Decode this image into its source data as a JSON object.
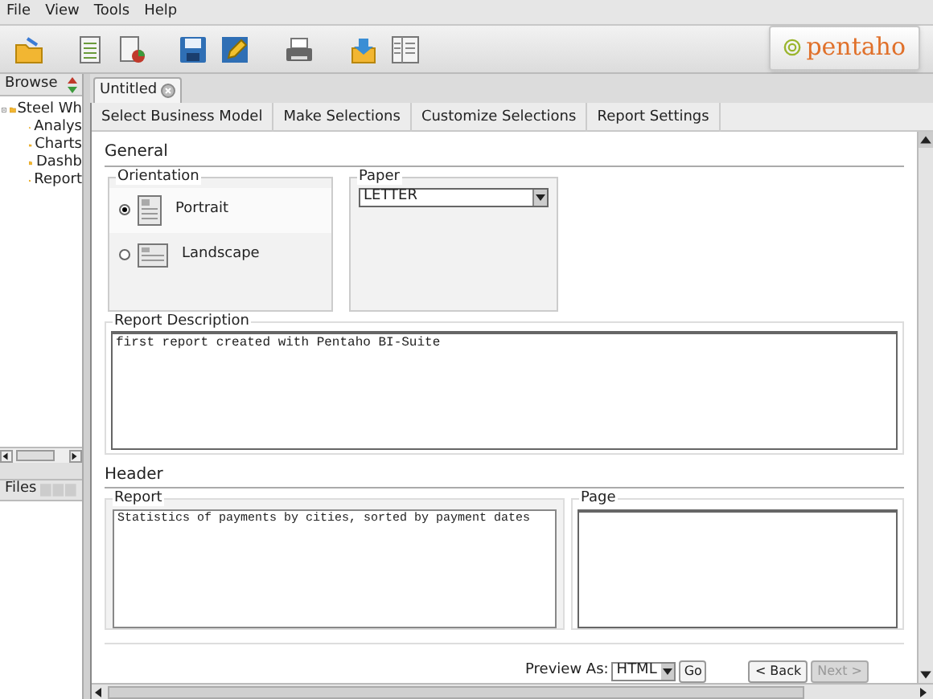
{
  "menu": [
    "File",
    "View",
    "Tools",
    "Help"
  ],
  "logo": {
    "text": "pentaho"
  },
  "browse": {
    "title": "Browse",
    "tree": [
      {
        "label": "Steel Wh",
        "expanded": true,
        "children": [
          {
            "label": "Analys"
          },
          {
            "label": "Charts"
          },
          {
            "label": "Dashb"
          },
          {
            "label": "Report"
          }
        ]
      }
    ]
  },
  "files": {
    "title": "Files"
  },
  "document_tab": {
    "label": "Untitled"
  },
  "steps": [
    "Select Business Model",
    "Make Selections",
    "Customize Selections",
    "Report Settings"
  ],
  "general": {
    "title": "General",
    "orientation": {
      "title": "Orientation",
      "options": [
        {
          "label": "Portrait",
          "selected": true
        },
        {
          "label": "Landscape",
          "selected": false
        }
      ]
    },
    "paper": {
      "title": "Paper",
      "value": "LETTER"
    }
  },
  "report_description": {
    "title": "Report Description",
    "value": "first report created with Pentaho BI-Suite"
  },
  "header": {
    "title": "Header",
    "report": {
      "title": "Report",
      "value": "Statistics of payments by cities, sorted by payment dates"
    },
    "page": {
      "title": "Page"
    }
  },
  "preview": {
    "label": "Preview As:",
    "format": "HTML",
    "go": "Go"
  },
  "back": {
    "label": "< Back",
    "disabled": false
  },
  "next": {
    "label": "Next >",
    "disabled": true
  }
}
